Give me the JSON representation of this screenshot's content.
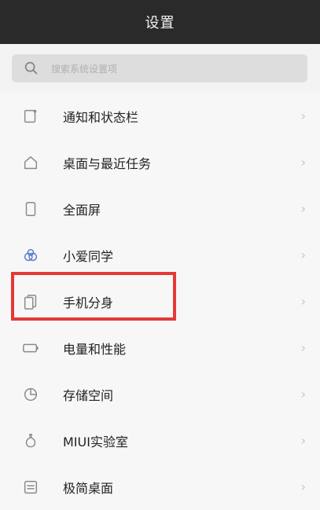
{
  "header": {
    "title": "设置"
  },
  "search": {
    "placeholder": "搜索系统设置项"
  },
  "items": [
    {
      "label": "通知和状态栏",
      "icon": "notification-icon"
    },
    {
      "label": "桌面与最近任务",
      "icon": "home-icon"
    },
    {
      "label": "全面屏",
      "icon": "phone-screen-icon"
    },
    {
      "label": "小爱同学",
      "icon": "assistant-icon"
    },
    {
      "label": "手机分身",
      "icon": "dual-phone-icon"
    },
    {
      "label": "电量和性能",
      "icon": "battery-icon"
    },
    {
      "label": "存储空间",
      "icon": "storage-icon"
    },
    {
      "label": "MIUI实验室",
      "icon": "flask-icon"
    },
    {
      "label": "极简桌面",
      "icon": "simple-desktop-icon"
    }
  ],
  "colors": {
    "highlight": "#e53935",
    "header_bg": "#2a2a2a"
  }
}
